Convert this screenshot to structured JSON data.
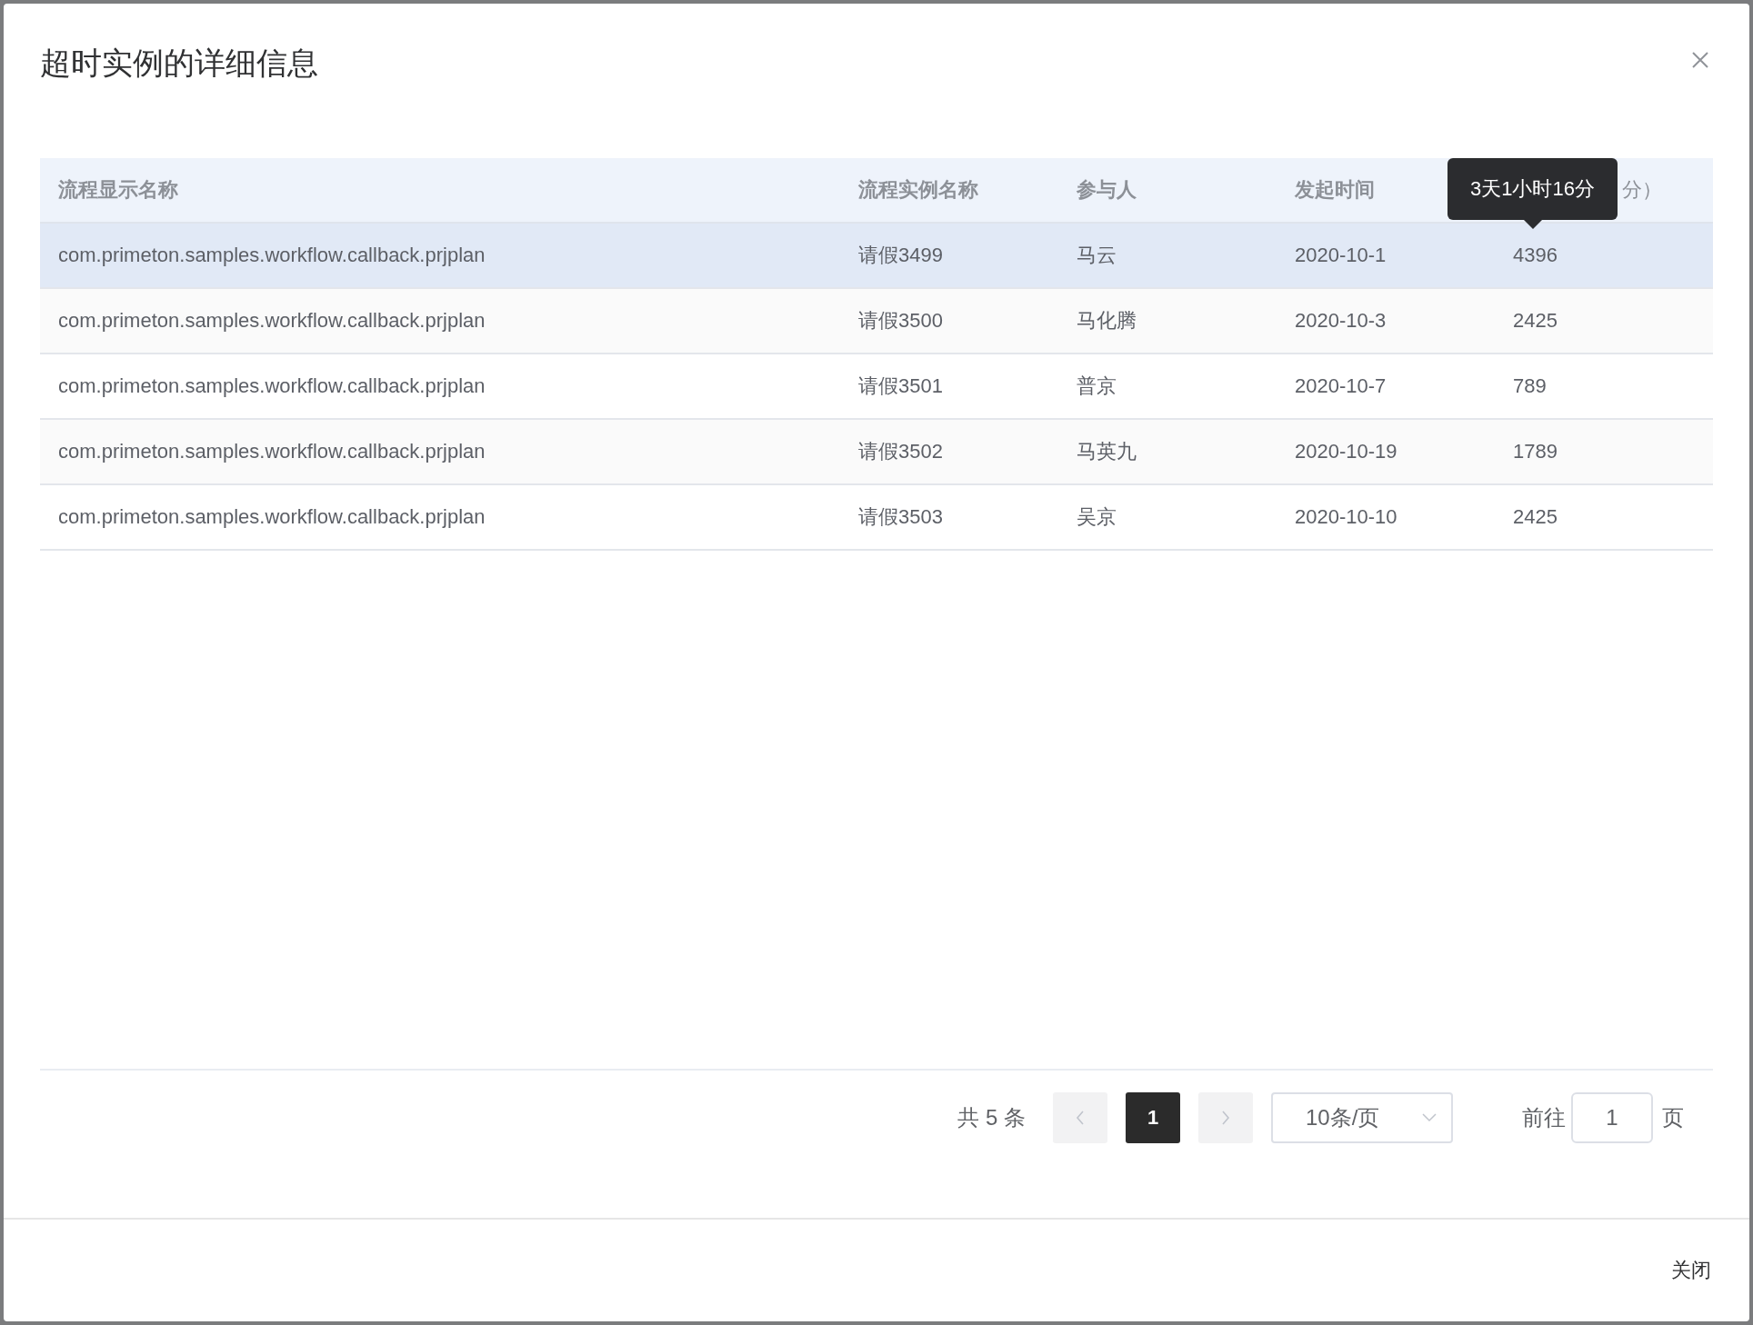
{
  "dialog": {
    "title": "超时实例的详细信息"
  },
  "table": {
    "columns": [
      "流程显示名称",
      "流程实例名称",
      "参与人",
      "发起时间",
      "分）"
    ],
    "rows": [
      {
        "cells": [
          "com.primeton.samples.workflow.callback.prjplan",
          "请假3499",
          "马云",
          "2020-10-1",
          "4396"
        ],
        "hovered": true
      },
      {
        "cells": [
          "com.primeton.samples.workflow.callback.prjplan",
          "请假3500",
          "马化腾",
          "2020-10-3",
          "2425"
        ],
        "hovered": false
      },
      {
        "cells": [
          "com.primeton.samples.workflow.callback.prjplan",
          "请假3501",
          "普京",
          "2020-10-7",
          "789"
        ],
        "hovered": false
      },
      {
        "cells": [
          "com.primeton.samples.workflow.callback.prjplan",
          "请假3502",
          "马英九",
          "2020-10-19",
          "1789"
        ],
        "hovered": false
      },
      {
        "cells": [
          "com.primeton.samples.workflow.callback.prjplan",
          "请假3503",
          "吴京",
          "2020-10-10",
          "2425"
        ],
        "hovered": false
      }
    ]
  },
  "tooltip": {
    "text": "3天1小时16分"
  },
  "pagination": {
    "total": "共 5 条",
    "prev_disabled": true,
    "pages": [
      {
        "label": "1",
        "selected": true
      }
    ],
    "next_disabled": true,
    "page_size": "10条/页",
    "goto_label": "前往",
    "goto_value": "1",
    "goto_suffix": "页"
  },
  "footer": {
    "close_button": "关闭"
  }
}
